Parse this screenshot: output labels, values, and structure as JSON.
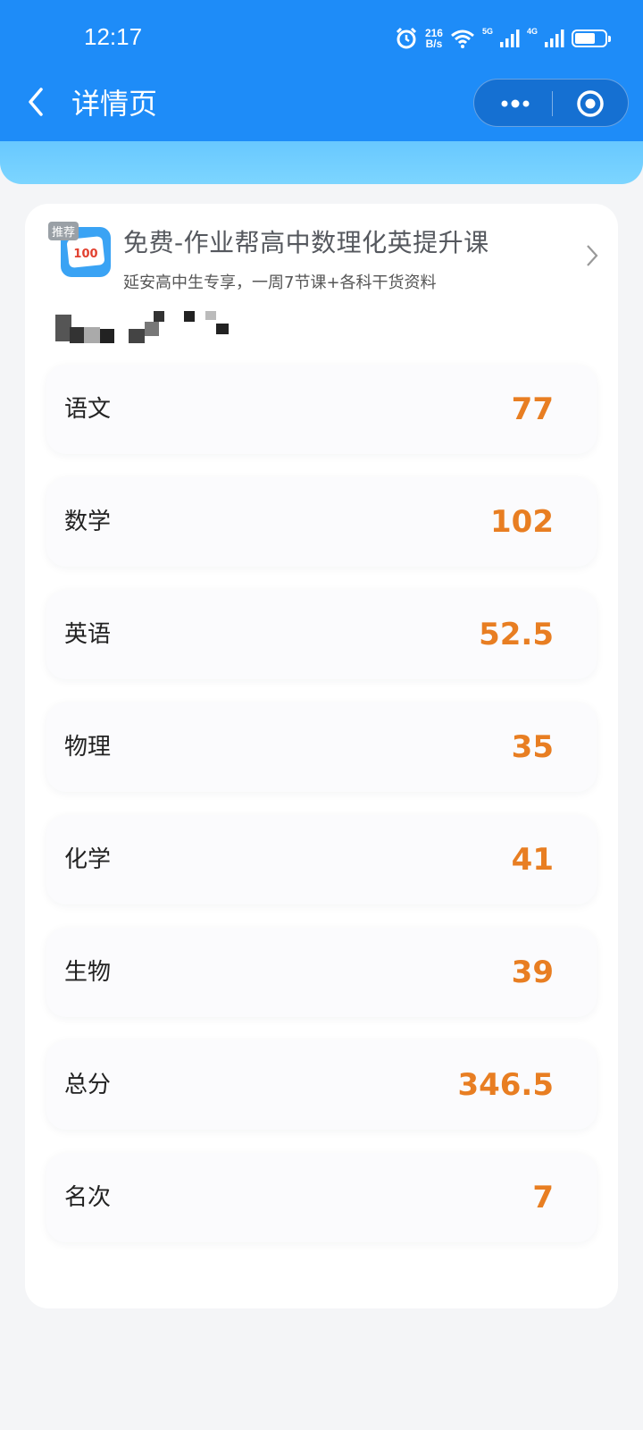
{
  "status_bar": {
    "time": "12:17",
    "net_speed_value": "216",
    "net_speed_unit": "B/s",
    "sim1_label": "5G",
    "sim2_label": "4G"
  },
  "nav": {
    "title": "详情页"
  },
  "promo": {
    "tag": "推荐",
    "icon_text": "100",
    "title": "免费-作业帮高中数理化英提升课",
    "subtitle": "延安高中生专享，一周7节课+各科干货资料"
  },
  "scores": [
    {
      "subject": "语文",
      "score": "77"
    },
    {
      "subject": "数学",
      "score": "102"
    },
    {
      "subject": "英语",
      "score": "52.5"
    },
    {
      "subject": "物理",
      "score": "35"
    },
    {
      "subject": "化学",
      "score": "41"
    },
    {
      "subject": "生物",
      "score": "39"
    },
    {
      "subject": "总分",
      "score": "346.5"
    },
    {
      "subject": "名次",
      "score": "7"
    }
  ],
  "colors": {
    "header": "#1e8cf8",
    "band": "#72cfff",
    "score": "#e87e22",
    "background": "#f4f5f7"
  }
}
